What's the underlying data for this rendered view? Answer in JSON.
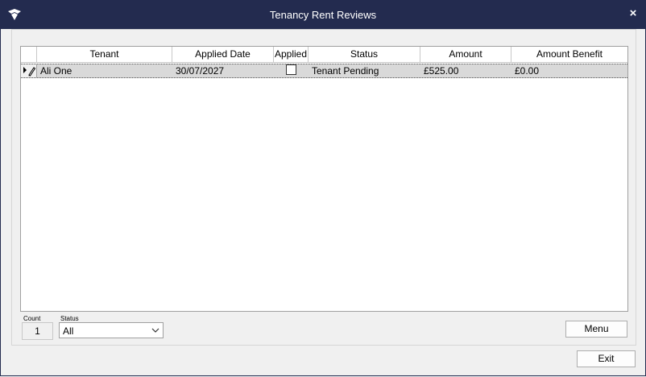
{
  "window": {
    "title": "Tenancy Rent Reviews",
    "close_symbol": "×"
  },
  "grid": {
    "columns": [
      "Tenant",
      "Applied Date",
      "Applied",
      "Status",
      "Amount",
      "Amount Benefit"
    ],
    "rows": [
      {
        "tenant": "Ali One",
        "applied_date": "30/07/2027",
        "applied": false,
        "status": "Tenant Pending",
        "amount": "£525.00",
        "amount_benefit": "£0.00"
      }
    ]
  },
  "footer": {
    "count_label": "Count",
    "count_value": "1",
    "status_label": "Status",
    "status_value": "All",
    "menu_label": "Menu",
    "exit_label": "Exit"
  },
  "colors": {
    "titlebar": "#232b4f",
    "selected_row": "#d9d9d9"
  }
}
